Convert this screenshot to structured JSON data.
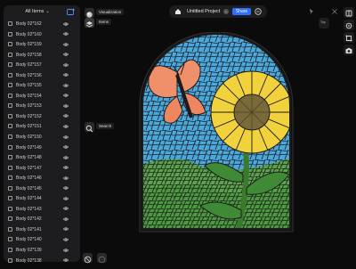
{
  "items_panel": {
    "title": "All Items",
    "items": [
      {
        "label": "Body 02*162"
      },
      {
        "label": "Body 02*160"
      },
      {
        "label": "Body 02*159"
      },
      {
        "label": "Body 02*158"
      },
      {
        "label": "Body 02*157"
      },
      {
        "label": "Body 02*156"
      },
      {
        "label": "Body 02*155"
      },
      {
        "label": "Body 02*154"
      },
      {
        "label": "Body 02*153"
      },
      {
        "label": "Body 02*152"
      },
      {
        "label": "Body 02*151"
      },
      {
        "label": "Body 02*150"
      },
      {
        "label": "Body 02*149"
      },
      {
        "label": "Body 02*148"
      },
      {
        "label": "Body 02*147"
      },
      {
        "label": "Body 02*146"
      },
      {
        "label": "Body 02*145"
      },
      {
        "label": "Body 02*144"
      },
      {
        "label": "Body 02*143"
      },
      {
        "label": "Body 02*142"
      },
      {
        "label": "Body 02*141"
      },
      {
        "label": "Body 02*140"
      },
      {
        "label": "Body 02*139"
      },
      {
        "label": "Body 02*138"
      }
    ]
  },
  "tools": {
    "visualization_label": "Visualization",
    "items_label": "Items",
    "search_label": "Search"
  },
  "topbar": {
    "project_title": "Untitled Project",
    "share_label": "Share"
  },
  "right_tools": {
    "view_label": "Top"
  },
  "colors": {
    "accent": "#2f6fff",
    "sky": "#4aa8dd",
    "grass": "#5aa34a",
    "sunflower": "#f2d23c",
    "butterfly": "#f0906a"
  }
}
